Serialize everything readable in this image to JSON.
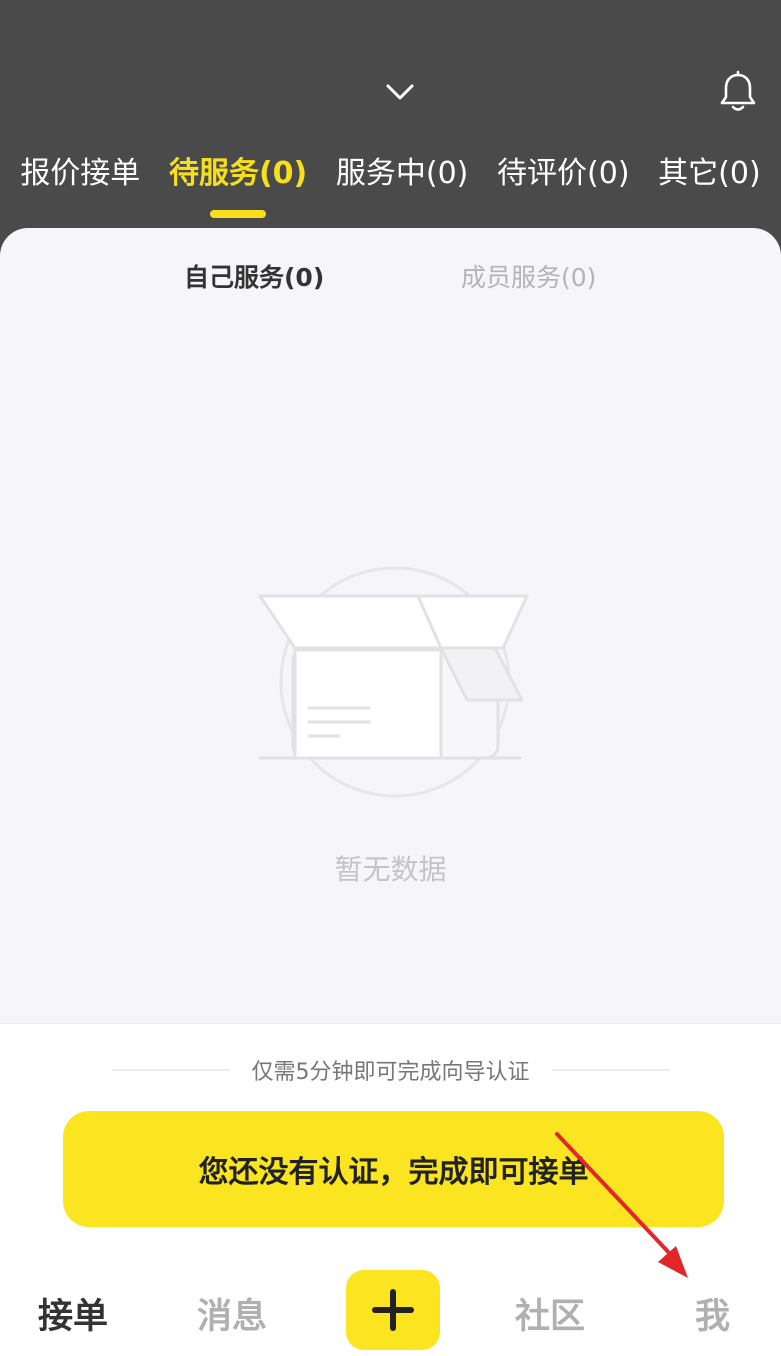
{
  "header": {
    "tabs": [
      {
        "label": "报价接单",
        "active": false
      },
      {
        "label": "待服务(0)",
        "active": true
      },
      {
        "label": "服务中(0)",
        "active": false
      },
      {
        "label": "待评价(0)",
        "active": false
      },
      {
        "label": "其它(0)",
        "active": false
      }
    ]
  },
  "subtabs": [
    {
      "label": "自己服务(0)",
      "active": true
    },
    {
      "label": "成员服务(0)",
      "active": false
    }
  ],
  "empty": {
    "text": "暂无数据"
  },
  "certification": {
    "tip": "仅需5分钟即可完成向导认证",
    "button_label": "您还没有认证，完成即可接单"
  },
  "nav": {
    "items": [
      {
        "label": "接单",
        "active": true
      },
      {
        "label": "消息",
        "active": false
      },
      {
        "label": "社区",
        "active": false
      },
      {
        "label": "我",
        "active": false
      }
    ]
  },
  "colors": {
    "header_bg": "#4a4a4a",
    "accent": "#f7e01b",
    "button_yellow": "#fbe521",
    "arrow_red": "#e3262a"
  }
}
